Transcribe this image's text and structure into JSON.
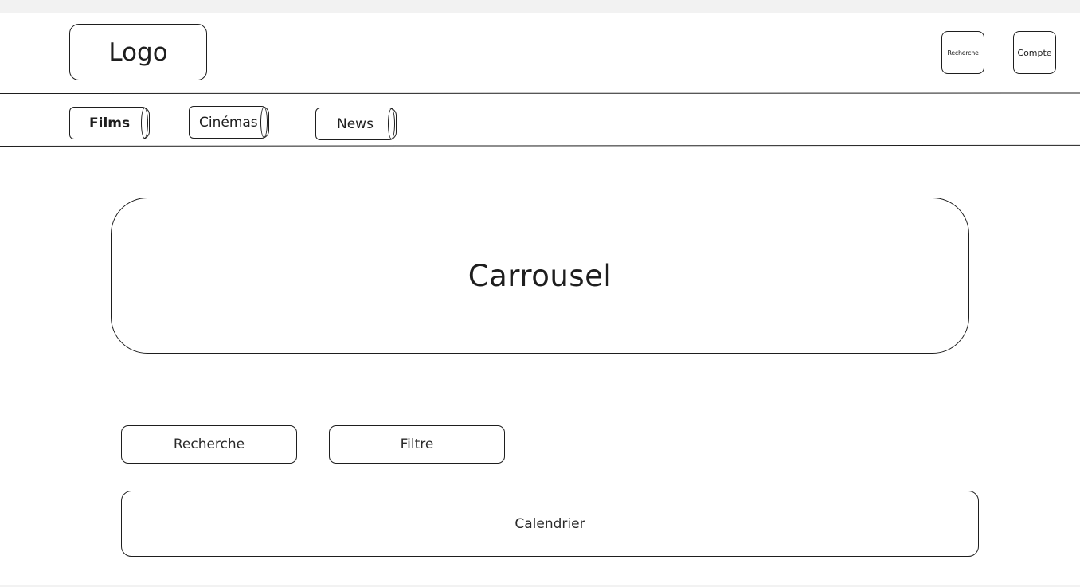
{
  "header": {
    "logo_label": "Logo",
    "search_icon_label": "Recherche",
    "account_label": "Compte"
  },
  "nav": {
    "tabs": [
      {
        "label": "Films",
        "active": true
      },
      {
        "label": "Cinémas",
        "active": false
      },
      {
        "label": "News",
        "active": false
      }
    ]
  },
  "main": {
    "carousel_label": "Carrousel",
    "search_button_label": "Recherche",
    "filter_button_label": "Filtre",
    "calendar_label": "Calendrier"
  }
}
